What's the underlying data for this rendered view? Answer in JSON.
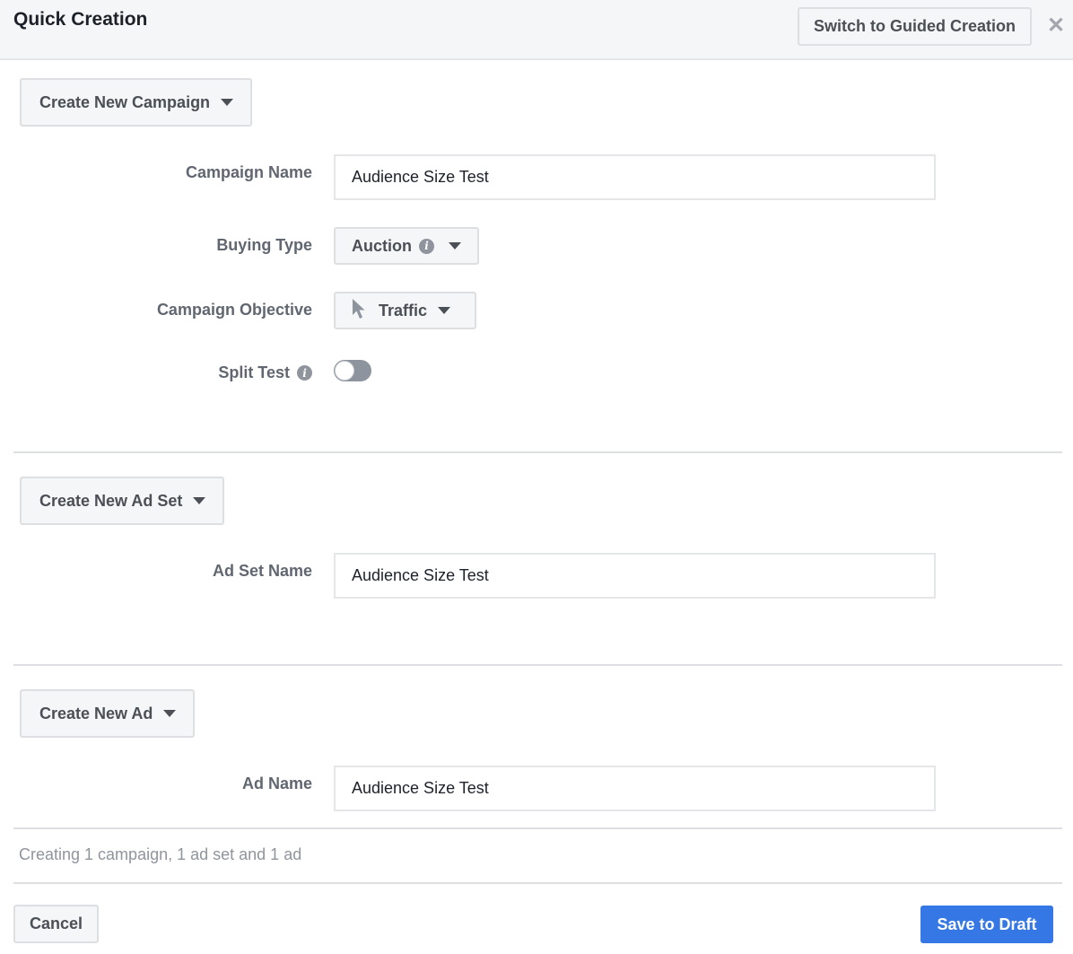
{
  "header": {
    "title": "Quick Creation",
    "switch_label": "Switch to Guided Creation",
    "close_icon": "close-icon"
  },
  "campaign": {
    "section_button": "Create New Campaign",
    "name_label": "Campaign Name",
    "name_value": "Audience Size Test",
    "buying_type_label": "Buying Type",
    "buying_type_value": "Auction",
    "objective_label": "Campaign Objective",
    "objective_value": "Traffic",
    "split_test_label": "Split Test",
    "split_test_enabled": false
  },
  "ad_set": {
    "section_button": "Create New Ad Set",
    "name_label": "Ad Set Name",
    "name_value": "Audience Size Test"
  },
  "ad": {
    "section_button": "Create New Ad",
    "name_label": "Ad Name",
    "name_value": "Audience Size Test"
  },
  "footer": {
    "summary": "Creating 1 campaign, 1 ad set and 1 ad",
    "cancel_label": "Cancel",
    "save_label": "Save to Draft"
  },
  "colors": {
    "primary": "#3578e5",
    "header_bg": "#f5f6f7",
    "toggle_off": "#8d949e"
  }
}
